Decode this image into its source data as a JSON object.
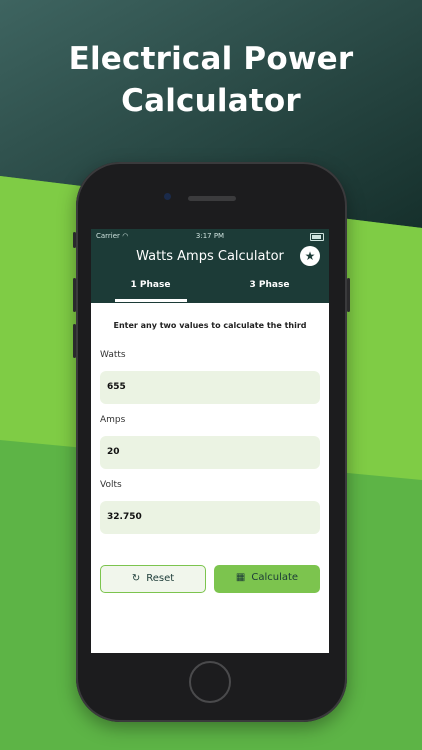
{
  "headline": {
    "line1": "Electrical Power",
    "line2": "Calculator"
  },
  "colors": {
    "dark": "#1c3b37",
    "green_light": "#7fcc45",
    "green": "#5fb346",
    "accent": "#7cc44e"
  },
  "status_bar": {
    "carrier": "Carrier",
    "time": "3:17 PM"
  },
  "app": {
    "title": "Watts Amps Calculator",
    "favorite_icon": "star-icon",
    "tabs": [
      {
        "label": "1 Phase",
        "selected": true
      },
      {
        "label": "3 Phase",
        "selected": false
      }
    ],
    "hint": "Enter any two values to calculate the third",
    "fields": [
      {
        "label": "Watts",
        "value": "655"
      },
      {
        "label": "Amps",
        "value": "20"
      },
      {
        "label": "Volts",
        "value": "32.750"
      }
    ],
    "buttons": {
      "reset": "Reset",
      "calculate": "Calculate"
    }
  }
}
